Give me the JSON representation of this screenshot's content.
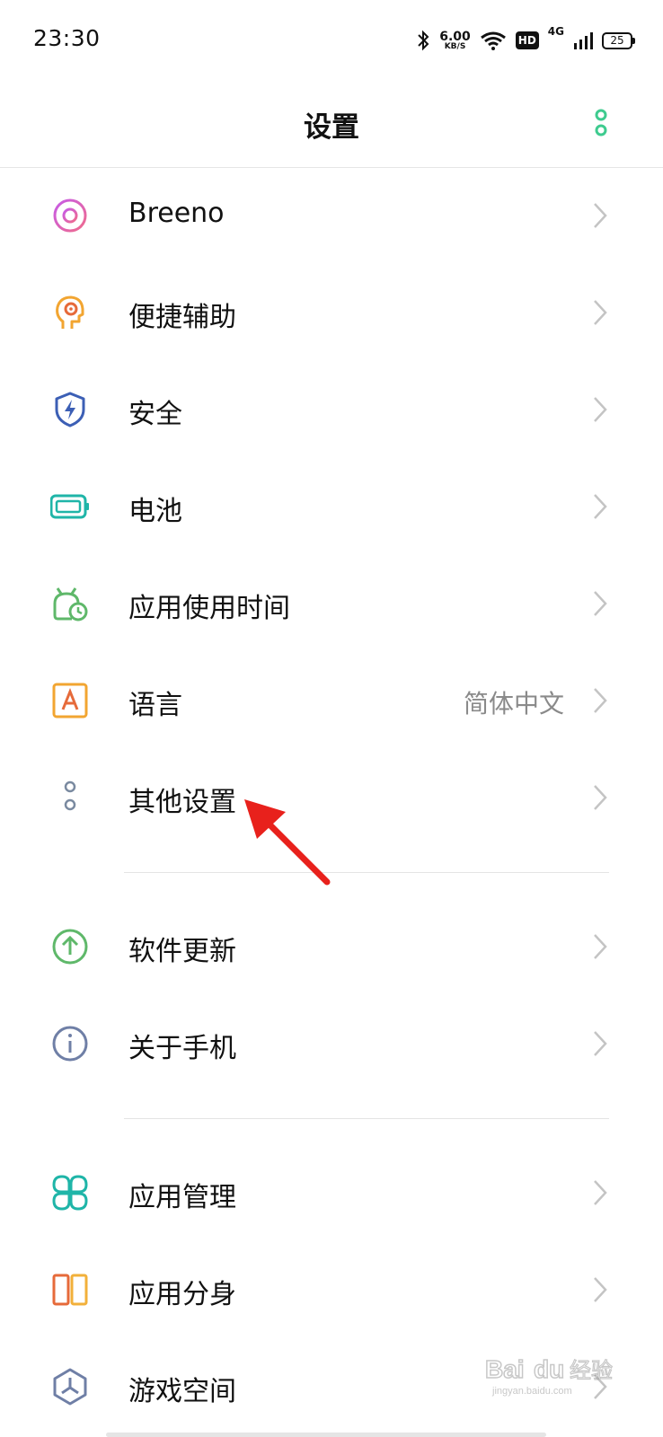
{
  "status_bar": {
    "time": "23:30",
    "net_speed": "6.00",
    "net_unit": "KB/S",
    "hd_label": "HD",
    "network_type": "4G",
    "battery_level": "25"
  },
  "header": {
    "title": "设置"
  },
  "items": [
    {
      "label": "Breeno",
      "value": "",
      "icon": "breeno-icon"
    },
    {
      "label": "便捷辅助",
      "value": "",
      "icon": "assist-icon"
    },
    {
      "label": "安全",
      "value": "",
      "icon": "shield-icon"
    },
    {
      "label": "电池",
      "value": "",
      "icon": "battery-icon"
    },
    {
      "label": "应用使用时间",
      "value": "",
      "icon": "alarm-clock-icon"
    },
    {
      "label": "语言",
      "value": "简体中文",
      "icon": "language-icon"
    },
    {
      "label": "其他设置",
      "value": "",
      "icon": "other-settings-icon"
    },
    {
      "label": "软件更新",
      "value": "",
      "icon": "update-arrow-icon"
    },
    {
      "label": "关于手机",
      "value": "",
      "icon": "info-icon"
    },
    {
      "label": "应用管理",
      "value": "",
      "icon": "app-grid-icon"
    },
    {
      "label": "应用分身",
      "value": "",
      "icon": "app-clone-icon"
    },
    {
      "label": "游戏空间",
      "value": "",
      "icon": "game-space-icon"
    }
  ],
  "colors": {
    "accent": "#3ecb8f",
    "divider": "#e4e4e4",
    "arrow": "#e8211c"
  },
  "watermark": {
    "brand": "Bai du",
    "suffix": "经验",
    "url": "jingyan.baidu.com"
  }
}
